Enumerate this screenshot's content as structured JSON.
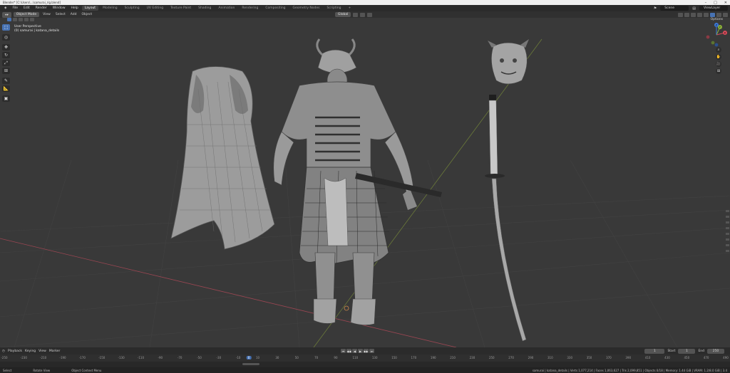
{
  "window": {
    "title": "Blender* [C:\\Users\\...\\samurai_rig.blend]",
    "controls": [
      "–",
      "□",
      "✕"
    ]
  },
  "menubar": {
    "menus": [
      "File",
      "Edit",
      "Render",
      "Window",
      "Help"
    ],
    "workspaces": [
      "Layout",
      "Modeling",
      "Sculpting",
      "UV Editing",
      "Texture Paint",
      "Shading",
      "Animation",
      "Rendering",
      "Compositing",
      "Geometry Nodes",
      "Scripting"
    ],
    "add_tab": "+",
    "scene": "Scene",
    "view_layer": "ViewLayer"
  },
  "header": {
    "mode": "Object Mode",
    "menus": [
      "View",
      "Select",
      "Add",
      "Object"
    ],
    "orientation": "Global",
    "options": "Options"
  },
  "viewport": {
    "view_name": "User Perspective",
    "collection_info": "(0) samurai | katana_details"
  },
  "toolbar": {
    "tools": [
      {
        "name": "select-box-tool",
        "glyph": "⬚"
      },
      {
        "name": "cursor-tool",
        "glyph": "◎"
      },
      {
        "name": "move-tool",
        "glyph": "✥"
      },
      {
        "name": "rotate-tool",
        "glyph": "↻"
      },
      {
        "name": "scale-tool",
        "glyph": "⤢"
      },
      {
        "name": "transform-tool",
        "glyph": "⊞"
      },
      {
        "name": "annotate-tool",
        "glyph": "✎"
      },
      {
        "name": "measure-tool",
        "glyph": "📐"
      },
      {
        "name": "add-cube-tool",
        "glyph": "▣"
      }
    ]
  },
  "nav": {
    "zoom": "⌕",
    "pan": "✋",
    "camera": "🎥",
    "ortho": "⊞",
    "axes": {
      "x": "X",
      "y": "Y",
      "z": "Z"
    }
  },
  "timeline": {
    "menus": [
      "Playback",
      "Keying",
      "View",
      "Marker"
    ],
    "play_controls": [
      "⏮",
      "◀◀",
      "◀",
      "▶",
      "▶▶",
      "⏭"
    ],
    "current_frame": "1",
    "start_label": "Start",
    "start": "1",
    "end_label": "End",
    "end": "250",
    "ruler": [
      "-250",
      "-230",
      "-210",
      "-190",
      "-170",
      "-150",
      "-130",
      "-110",
      "-90",
      "-70",
      "-50",
      "-30",
      "-10",
      "10",
      "30",
      "50",
      "70",
      "90",
      "110",
      "130",
      "150",
      "170",
      "190",
      "210",
      "230",
      "250",
      "270",
      "290",
      "310",
      "330",
      "350",
      "370",
      "390",
      "410",
      "430",
      "450",
      "470",
      "490"
    ],
    "current_marker": "0"
  },
  "status": {
    "left": "Select",
    "middle1": "Rotate View",
    "middle2": "Object Context Menu",
    "stats": "samurai | katana_details | Verts 1,077,214 | Faces 1,063,627 | Tris 2,099,851 | Objects 0/18 | Memory: 1.44 GiB | VRAM: 1.2/8.0 GiB | 3.4"
  },
  "colors": {
    "accent": "#4772b3",
    "background": "#393939",
    "x_axis": "#d84b5a",
    "y_axis": "#8bb03a",
    "z_axis": "#3c78d8"
  }
}
